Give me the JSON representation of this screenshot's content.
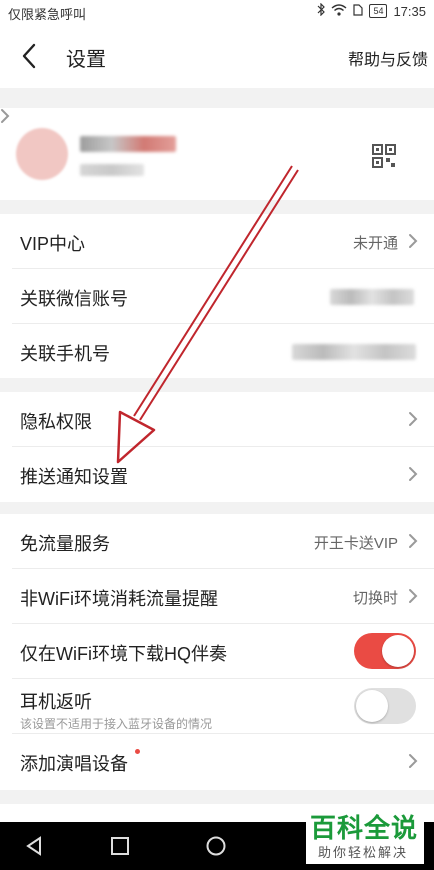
{
  "status_bar": {
    "left_text": "仅限紧急呼叫",
    "battery": "54",
    "time": "17:35"
  },
  "nav": {
    "title": "设置",
    "help": "帮助与反馈"
  },
  "profile": {},
  "section1": [
    {
      "label": "VIP中心",
      "value": "未开通"
    },
    {
      "label": "关联微信账号"
    },
    {
      "label": "关联手机号"
    }
  ],
  "section2": [
    {
      "label": "隐私权限"
    },
    {
      "label": "推送通知设置"
    }
  ],
  "section3": [
    {
      "label": "免流量服务",
      "value": "开王卡送VIP"
    },
    {
      "label": "非WiFi环境消耗流量提醒",
      "value": "切换时"
    },
    {
      "label": "仅在WiFi环境下载HQ伴奏",
      "toggle": true
    },
    {
      "label": "耳机返听",
      "sub": "该设置不适用于接入蓝牙设备的情况",
      "toggle": false
    },
    {
      "label": "添加演唱设备"
    }
  ],
  "watermark": {
    "line1": "百科全说",
    "line2": "助你轻松解决"
  },
  "colors": {
    "accent": "#ea4b44",
    "bg": "#f2f2f2",
    "annotation_arrow": "#c0262d"
  }
}
